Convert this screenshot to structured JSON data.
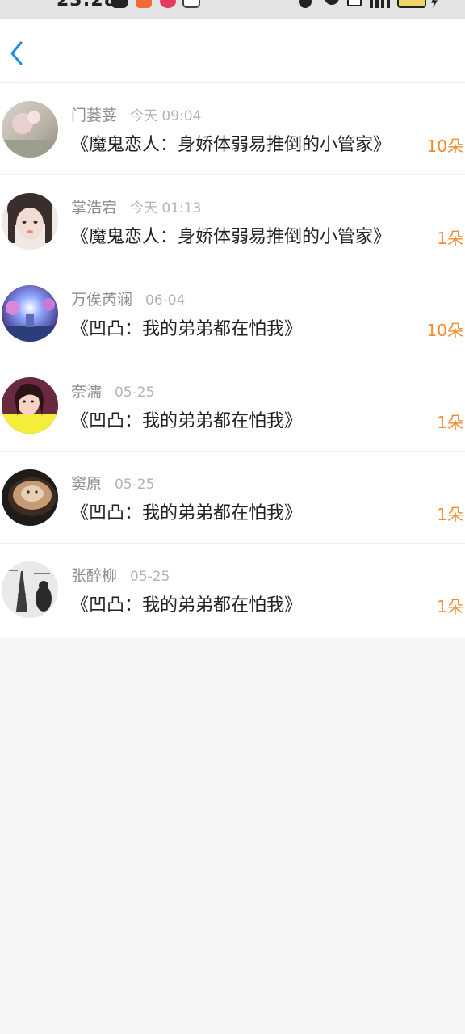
{
  "status_bar": {
    "time": "23:28"
  },
  "colors": {
    "accent_blue": "#1a8be8",
    "amount_orange": "#f28a2e"
  },
  "nav": {
    "back_icon": "chevron-left-icon"
  },
  "records": [
    {
      "name": "门蒌荽",
      "time": "今天 09:04",
      "title": "《魔鬼恋人：身娇体弱易推倒的小管家》",
      "amount": "10朵"
    },
    {
      "name": "掌浩宕",
      "time": "今天 01:13",
      "title": "《魔鬼恋人：身娇体弱易推倒的小管家》",
      "amount": "1朵"
    },
    {
      "name": "万俟芮澜",
      "time": "06-04",
      "title": "《凹凸：我的弟弟都在怕我》",
      "amount": "10朵"
    },
    {
      "name": "奈濡",
      "time": "05-25",
      "title": "《凹凸：我的弟弟都在怕我》",
      "amount": "1朵"
    },
    {
      "name": "窦原",
      "time": "05-25",
      "title": "《凹凸：我的弟弟都在怕我》",
      "amount": "1朵"
    },
    {
      "name": "张醉柳",
      "time": "05-25",
      "title": "《凹凸：我的弟弟都在怕我》",
      "amount": "1朵"
    }
  ]
}
